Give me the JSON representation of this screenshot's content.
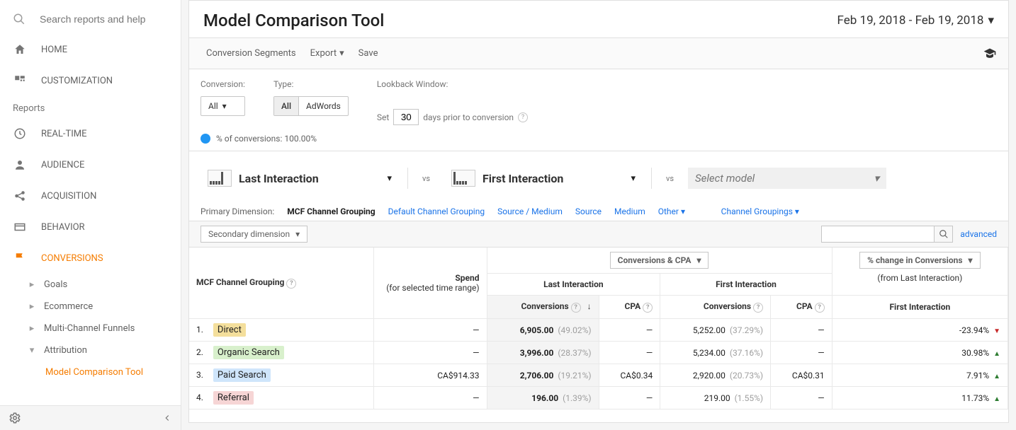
{
  "search_placeholder": "Search reports and help",
  "nav": {
    "home": "HOME",
    "customization": "CUSTOMIZATION",
    "reports_label": "Reports",
    "realtime": "REAL-TIME",
    "audience": "AUDIENCE",
    "acquisition": "ACQUISITION",
    "behavior": "BEHAVIOR",
    "conversions": "CONVERSIONS",
    "goals": "Goals",
    "ecommerce": "Ecommerce",
    "multichannel": "Multi-Channel Funnels",
    "attribution": "Attribution",
    "model_tool": "Model Comparison Tool"
  },
  "page": {
    "title": "Model Comparison Tool",
    "date_range": "Feb 19, 2018 - Feb 19, 2018"
  },
  "toolbar": {
    "segments": "Conversion Segments",
    "export": "Export",
    "save": "Save"
  },
  "config": {
    "conversion_label": "Conversion:",
    "conversion_all": "All",
    "type_label": "Type:",
    "type_all": "All",
    "type_adwords": "AdWords",
    "lookback_label": "Lookback Window:",
    "lookback_prefix": "Set",
    "lookback_days": "30",
    "lookback_suffix": "days prior to conversion",
    "pct_text": "% of conversions: 100.00%"
  },
  "models": {
    "m1": "Last Interaction",
    "m2": "First Interaction",
    "placeholder": "Select model",
    "vs": "vs"
  },
  "dims": {
    "label": "Primary Dimension:",
    "active": "MCF Channel Grouping",
    "d1": "Default Channel Grouping",
    "d2": "Source / Medium",
    "d3": "Source",
    "d4": "Medium",
    "d5": "Other",
    "groupings": "Channel Groupings",
    "secondary": "Secondary dimension",
    "advanced": "advanced"
  },
  "table": {
    "col_channel": "MCF Channel Grouping",
    "col_spend_1": "Spend",
    "col_spend_2": "(for selected time range)",
    "col_conv": "Conversions",
    "col_cpa": "CPA",
    "group_ccpa": "Conversions & CPA",
    "change_label": "% change in Conversions",
    "change_sub": "(from Last Interaction)",
    "rows": [
      {
        "n": "1.",
        "name": "Direct",
        "chip": "gold",
        "spend": "—",
        "li_conv": "6,905.00",
        "li_pct": "(49.02%)",
        "li_cpa": "—",
        "fi_conv": "5,252.00",
        "fi_pct": "(37.29%)",
        "fi_cpa": "—",
        "change": "-23.94%",
        "dir": "down"
      },
      {
        "n": "2.",
        "name": "Organic Search",
        "chip": "green",
        "spend": "—",
        "li_conv": "3,996.00",
        "li_pct": "(28.37%)",
        "li_cpa": "—",
        "fi_conv": "5,234.00",
        "fi_pct": "(37.16%)",
        "fi_cpa": "—",
        "change": "30.98%",
        "dir": "up"
      },
      {
        "n": "3.",
        "name": "Paid Search",
        "chip": "blue",
        "spend": "CA$914.33",
        "li_conv": "2,706.00",
        "li_pct": "(19.21%)",
        "li_cpa": "CA$0.34",
        "fi_conv": "2,920.00",
        "fi_pct": "(20.73%)",
        "fi_cpa": "CA$0.31",
        "change": "7.91%",
        "dir": "up"
      },
      {
        "n": "4.",
        "name": "Referral",
        "chip": "pink",
        "spend": "—",
        "li_conv": "196.00",
        "li_pct": "(1.39%)",
        "li_cpa": "—",
        "fi_conv": "219.00",
        "fi_pct": "(1.55%)",
        "fi_cpa": "—",
        "change": "11.73%",
        "dir": "up"
      }
    ]
  }
}
